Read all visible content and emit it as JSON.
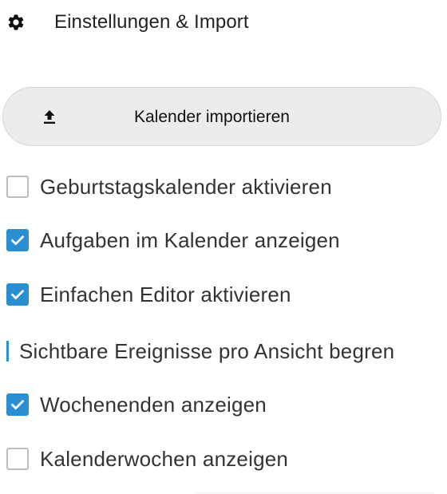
{
  "header": {
    "icon": "gear-icon",
    "title": "Einstellungen & Import"
  },
  "import_button": {
    "icon": "upload-icon",
    "label": "Kalender importieren"
  },
  "options": [
    {
      "label": "Geburtstagskalender aktivieren",
      "checked": false
    },
    {
      "label": "Aufgaben im Kalender anzeigen",
      "checked": true
    },
    {
      "label": "Einfachen Editor aktivieren",
      "checked": true
    },
    {
      "label": "Wochenenden anzeigen",
      "checked": true
    },
    {
      "label": "Kalenderwochen anzeigen",
      "checked": false
    }
  ],
  "limit_events": {
    "label": "Sichtbare Ereignisse pro Ansicht begren"
  },
  "colors": {
    "accent": "#2a8ed3",
    "button_bg": "#ececec",
    "text": "#333333"
  }
}
